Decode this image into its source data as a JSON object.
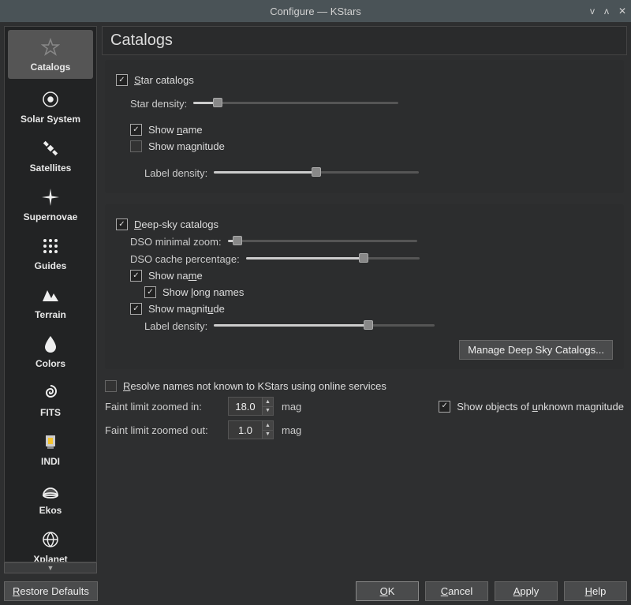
{
  "window": {
    "title": "Configure — KStars"
  },
  "sidebar": {
    "items": [
      {
        "label": "Catalogs"
      },
      {
        "label": "Solar System"
      },
      {
        "label": "Satellites"
      },
      {
        "label": "Supernovae"
      },
      {
        "label": "Guides"
      },
      {
        "label": "Terrain"
      },
      {
        "label": "Colors"
      },
      {
        "label": "FITS"
      },
      {
        "label": "INDI"
      },
      {
        "label": "Ekos"
      },
      {
        "label": "Xplanet"
      }
    ]
  },
  "page": {
    "title": "Catalogs",
    "star_catalogs": {
      "label": "Star catalogs",
      "checked": true,
      "star_density_label": "Star density:",
      "star_density_pct": 12,
      "show_name": {
        "label": "Show name",
        "checked": true
      },
      "show_magnitude": {
        "label": "Show magnitude",
        "checked": false
      },
      "label_density_label": "Label density:",
      "label_density_pct": 50
    },
    "deep_sky": {
      "label": "Deep-sky catalogs",
      "checked": true,
      "dso_min_zoom_label": "DSO minimal zoom:",
      "dso_min_zoom_pct": 5,
      "dso_cache_label": "DSO cache percentage:",
      "dso_cache_pct": 68,
      "show_name": {
        "label": "Show name",
        "checked": true
      },
      "show_long": {
        "label": "Show long names",
        "checked": true
      },
      "show_magnitude": {
        "label": "Show magnitude",
        "checked": true
      },
      "label_density_label": "Label density:",
      "label_density_pct": 70,
      "manage_label": "Manage Deep Sky Catalogs..."
    },
    "resolve": {
      "label": "Resolve names not known to KStars using online services",
      "checked": false
    },
    "faint_in": {
      "label": "Faint limit zoomed in:",
      "value": "18.0",
      "unit": "mag"
    },
    "faint_out": {
      "label": "Faint limit zoomed out:",
      "value": "1.0",
      "unit": "mag"
    },
    "show_unknown": {
      "label": "Show objects of unknown magnitude",
      "checked": true
    }
  },
  "footer": {
    "restore_defaults": "Restore Defaults",
    "ok": "OK",
    "cancel": "Cancel",
    "apply": "Apply",
    "help": "Help"
  }
}
